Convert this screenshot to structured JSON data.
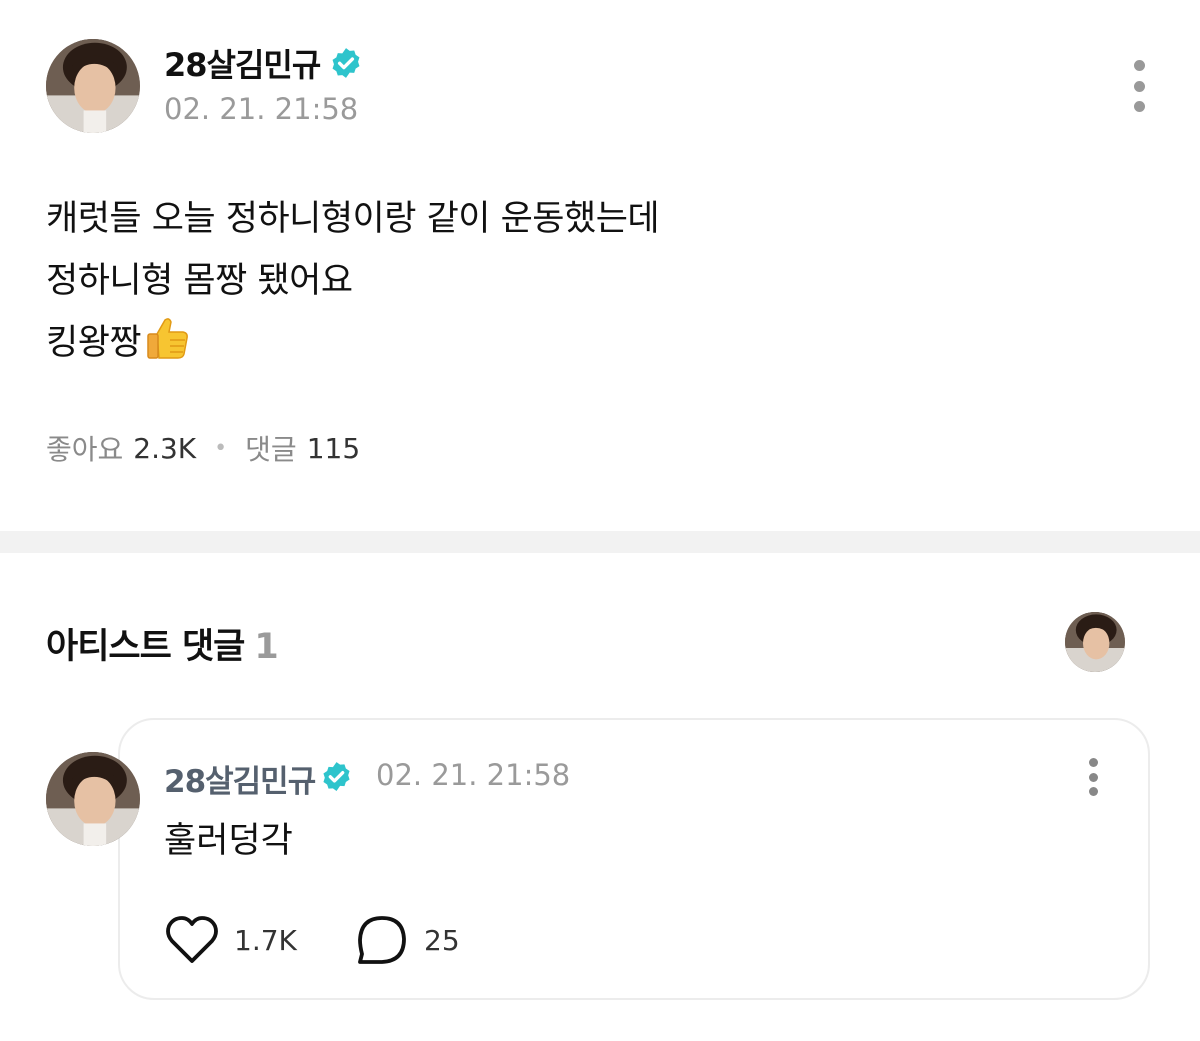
{
  "post": {
    "author": "28살김민규",
    "time": "02. 21. 21:58",
    "body_lines": [
      "캐럿들 오늘 정하니형이랑 같이 운동했는데",
      "정하니형 몸짱 됐어요",
      "킹왕짱"
    ],
    "likes_label": "좋아요",
    "likes_count": "2.3K",
    "comments_label": "댓글",
    "comments_count": "115"
  },
  "artist_comments": {
    "title": "아티스트 댓글",
    "count": "1",
    "items": [
      {
        "author": "28살김민규",
        "time": "02. 21. 21:58",
        "text": "훌러덩각",
        "likes": "1.7K",
        "replies": "25"
      }
    ]
  },
  "icons": {
    "verified": "verified-badge-icon",
    "thumb": "thumbs-up-emoji",
    "more": "more-vertical-icon",
    "like": "heart-outline-icon",
    "reply": "speech-bubble-icon"
  },
  "colors": {
    "verified": "#2ec4cc",
    "muted_text": "#9a9a9a",
    "comment_author": "#55606e",
    "divider": "#f2f2f2"
  }
}
